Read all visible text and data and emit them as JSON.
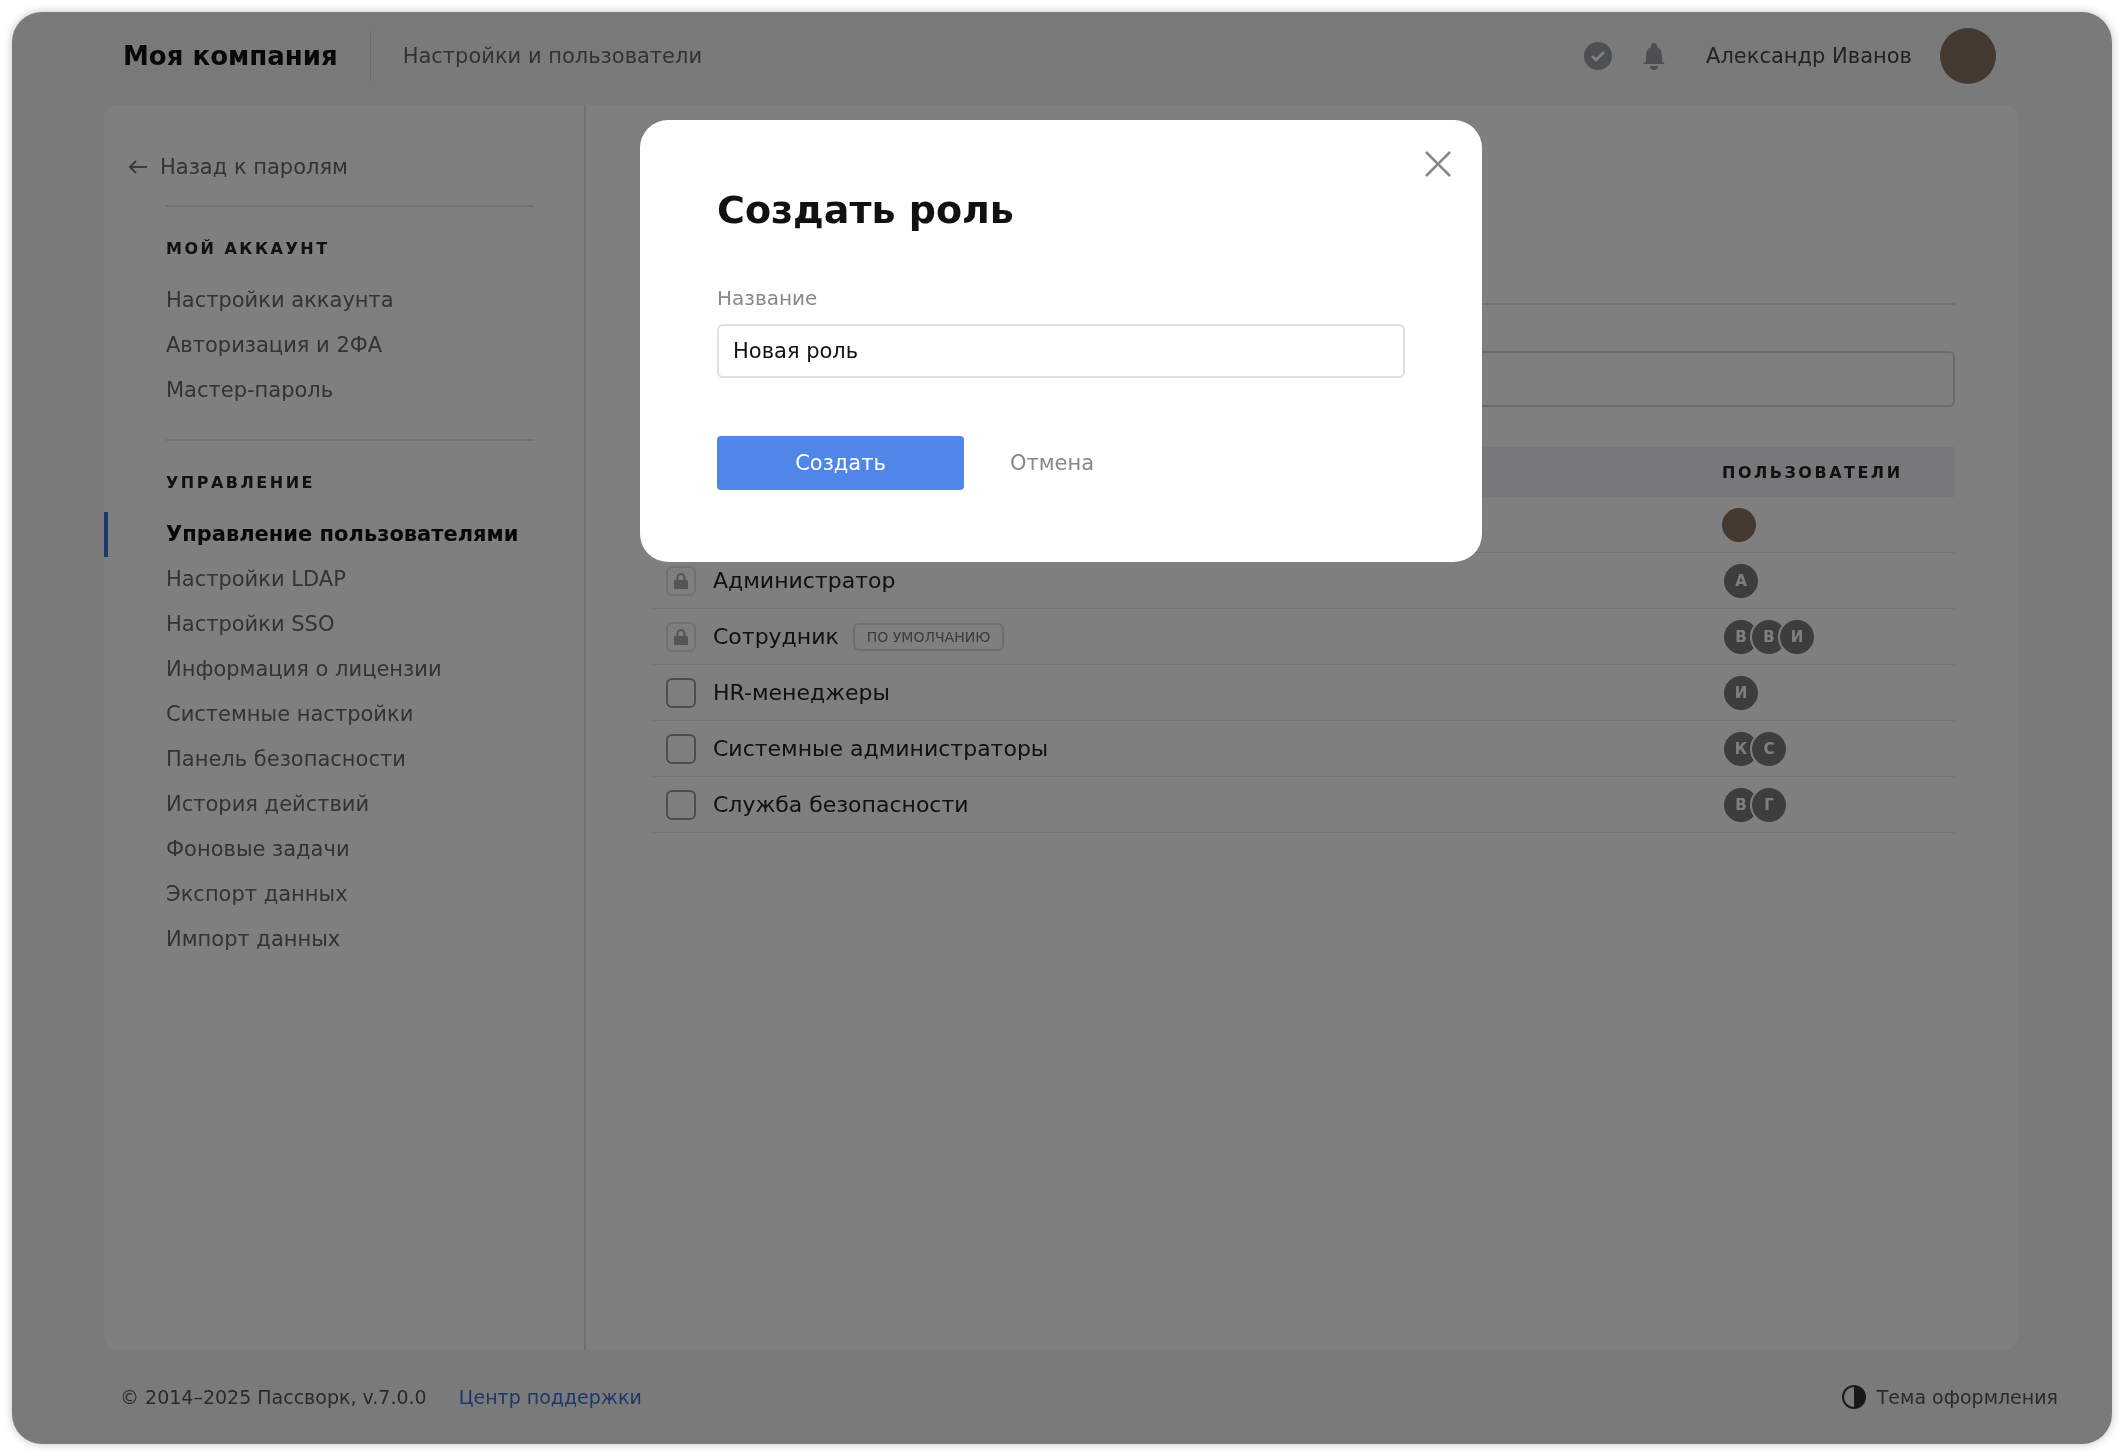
{
  "header": {
    "company": "Моя компания",
    "section": "Настройки и пользователи",
    "user_name": "Александр Иванов"
  },
  "sidebar": {
    "back_link": "Назад к паролям",
    "groups": [
      {
        "heading": "МОЙ АККАУНТ",
        "items": [
          {
            "label": "Настройки аккаунта",
            "selected": false
          },
          {
            "label": "Авторизация и 2ФА",
            "selected": false
          },
          {
            "label": "Мастер-пароль",
            "selected": false
          }
        ]
      },
      {
        "heading": "УПРАВЛЕНИЕ",
        "items": [
          {
            "label": "Управление пользователями",
            "selected": true
          },
          {
            "label": "Настройки LDAP",
            "selected": false
          },
          {
            "label": "Настройки SSO",
            "selected": false
          },
          {
            "label": "Информация о лицензии",
            "selected": false
          },
          {
            "label": "Системные настройки",
            "selected": false
          },
          {
            "label": "Панель безопасности",
            "selected": false
          },
          {
            "label": "История действий",
            "selected": false
          },
          {
            "label": "Фоновые задачи",
            "selected": false
          },
          {
            "label": "Экспорт данных",
            "selected": false
          },
          {
            "label": "Импорт данных",
            "selected": false
          }
        ]
      }
    ]
  },
  "roles_table": {
    "users_column": "ПОЛЬЗОВАТЕЛИ",
    "rows": [
      {
        "users": [
          {
            "kind": "photo"
          }
        ]
      },
      {
        "name": "Администратор",
        "locked": true,
        "users": [
          {
            "kind": "initial",
            "text": "А"
          }
        ]
      },
      {
        "name": "Сотрудник",
        "badge": "ПО УМОЛЧАНИЮ",
        "locked": true,
        "users": [
          {
            "kind": "initial",
            "text": "В"
          },
          {
            "kind": "initial",
            "text": "В"
          },
          {
            "kind": "initial",
            "text": "И"
          }
        ]
      },
      {
        "name": "HR-менеджеры",
        "locked": false,
        "checked": false,
        "users": [
          {
            "kind": "initial",
            "text": "И"
          }
        ]
      },
      {
        "name": "Системные администраторы",
        "locked": false,
        "checked": false,
        "users": [
          {
            "kind": "initial",
            "text": "К"
          },
          {
            "kind": "initial",
            "text": "С"
          }
        ]
      },
      {
        "name": "Служба безопасности",
        "locked": false,
        "checked": false,
        "users": [
          {
            "kind": "initial",
            "text": "В"
          },
          {
            "kind": "initial",
            "text": "Г"
          }
        ]
      }
    ]
  },
  "modal": {
    "title": "Создать роль",
    "field_label": "Название",
    "field_value": "Новая роль",
    "primary_button": "Создать",
    "cancel_button": "Отмена"
  },
  "footer": {
    "copyright": "© 2014–2025 Пассворк, v.7.0.0",
    "support_link": "Центр поддержки",
    "theme_toggle": "Тема оформления"
  }
}
